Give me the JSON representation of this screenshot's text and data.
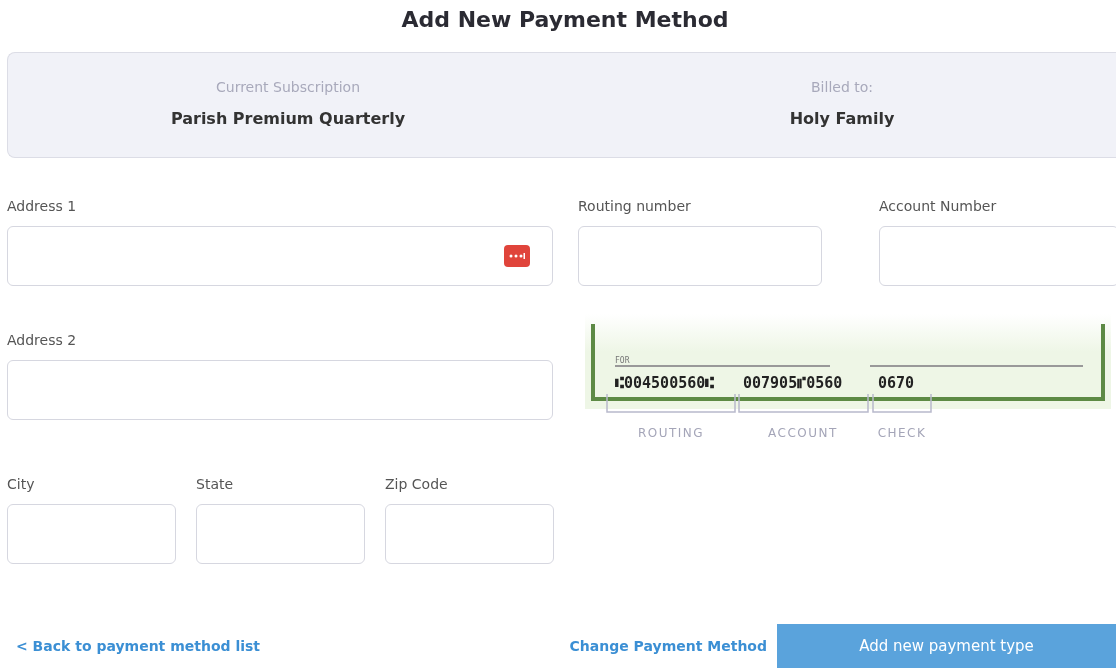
{
  "title": "Add New Payment Method",
  "summary": [
    {
      "label": "Current Subscription",
      "value": "Parish Premium Quarterly"
    },
    {
      "label": "Billed to:",
      "value": "Holy Family"
    }
  ],
  "address_fields": [
    {
      "label": "Address 1",
      "autofill_badge": true
    },
    {
      "label": "Address 2",
      "autofill_badge": false
    }
  ],
  "city_row": [
    {
      "label": "City"
    },
    {
      "label": "State"
    },
    {
      "label": "Zip Code"
    }
  ],
  "bank_fields": [
    {
      "label": "Routing number"
    },
    {
      "label": "Account Number"
    }
  ],
  "check_illustration": {
    "for_label": "FOR",
    "routing_number": "⑆004500560⑆",
    "account_number": "007905⑈0560",
    "check_number": "0670",
    "parts": [
      "ROUTING",
      "ACCOUNT",
      "CHECK"
    ]
  },
  "footer": {
    "back_link": "< Back to payment method list",
    "change_link": "Change Payment Method",
    "submit": "Add new payment type"
  }
}
